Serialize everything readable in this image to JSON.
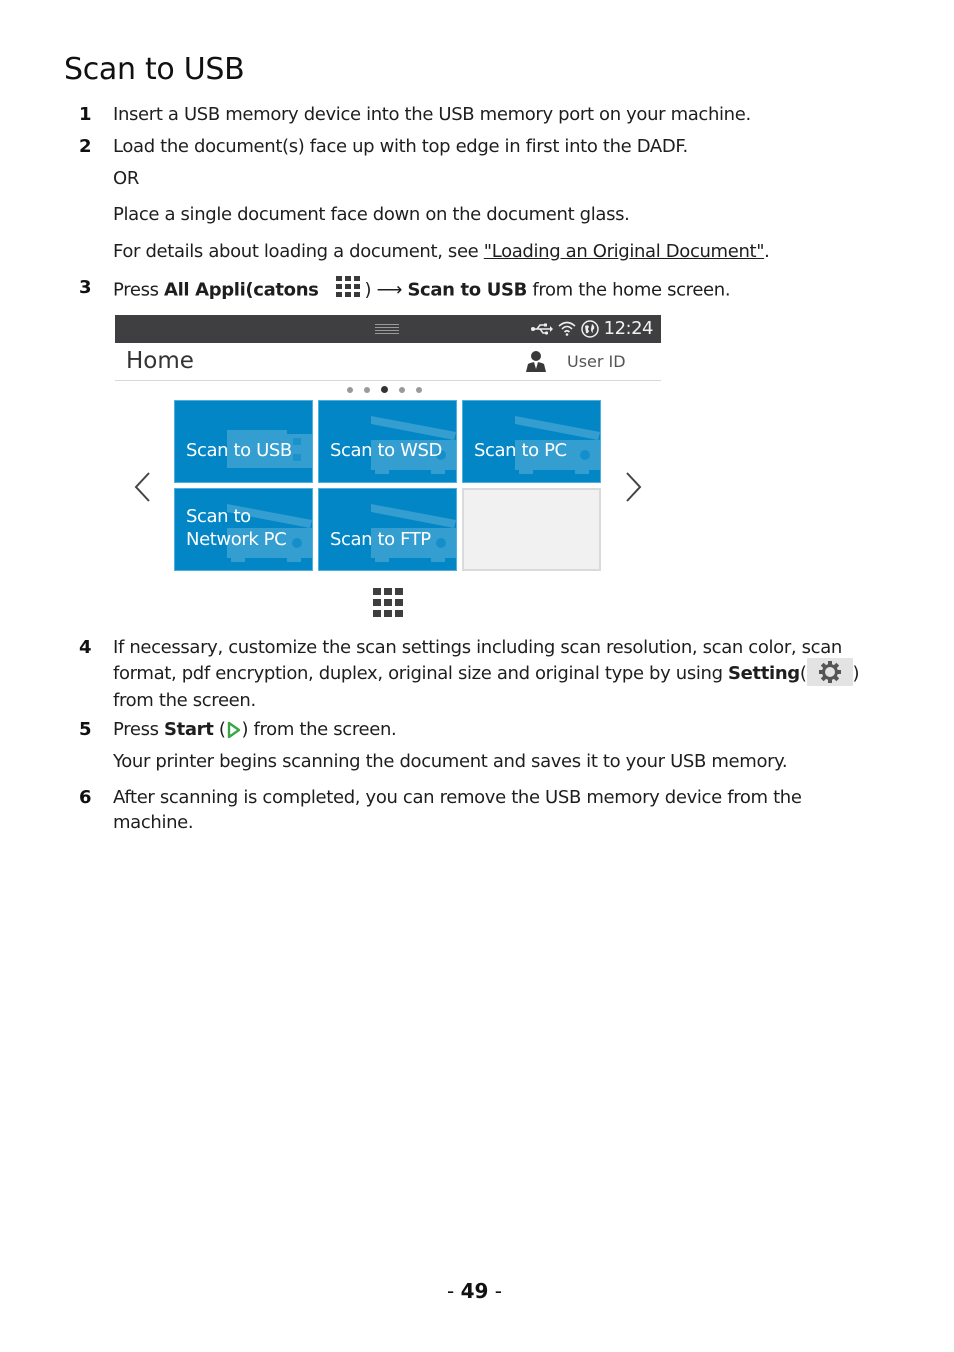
{
  "page": {
    "title": "Scan to USB",
    "page_number": "49"
  },
  "steps": [
    {
      "num": "1",
      "text": "Insert a USB memory device into the USB memory port on your machine."
    },
    {
      "num": "2",
      "text": "Load the document(s) face up with top edge in first into the DADF.",
      "or": "OR",
      "alt": "Place a single document face down on the document glass.",
      "details_prefix": "For details about loading a document, see ",
      "details_link": "\"Loading an Original Document\"",
      "details_suffix": "."
    },
    {
      "num": "3",
      "press": "Press ",
      "bold1": "All Appli(catons",
      "close_paren": ")",
      "arrow": "⟶",
      "bold2": "Scan to USB",
      "suffix": " from the home screen."
    },
    {
      "num": "4",
      "text_a": "If necessary, customize the scan settings including scan resolution, scan color, scan format, pdf encryption, duplex, original size and original type by using ",
      "bold": "Setting",
      "open_paren": "(",
      "close_paren": ")",
      "text_b": "from the screen."
    },
    {
      "num": "5",
      "press": "Press ",
      "bold": "Start",
      "paren_open": " (",
      "paren_close": ") from the screen.",
      "note": "Your printer begins scanning the document and saves it to your USB memory."
    },
    {
      "num": "6",
      "text": "After scanning is completed, you can remove the USB memory device from the machine."
    }
  ],
  "screen": {
    "status_time": "12:24",
    "status_icons": [
      "usb-icon",
      "wifi-icon",
      "globe-icon"
    ],
    "home_title": "Home",
    "user_label": "User ID",
    "page_dots": {
      "count": 5,
      "active_index": 2
    },
    "tiles": [
      {
        "label_line1": "Scan to USB",
        "label_line2": "",
        "icon": "usb-drive-icon"
      },
      {
        "label_line1": "Scan to WSD",
        "label_line2": "",
        "icon": "scanner-icon"
      },
      {
        "label_line1": "Scan to PC",
        "label_line2": "",
        "icon": "scanner-icon"
      },
      {
        "label_line1": "Scan to",
        "label_line2": "Network PC",
        "icon": "scanner-icon"
      },
      {
        "label_line1": "Scan to FTP",
        "label_line2": "",
        "icon": "scanner-icon"
      },
      {
        "label_line1": "",
        "label_line2": "",
        "icon": ""
      }
    ],
    "colors": {
      "tile_blue": "#0286c6",
      "status_bar": "#3f3f41",
      "start_green": "#3aa648"
    }
  }
}
